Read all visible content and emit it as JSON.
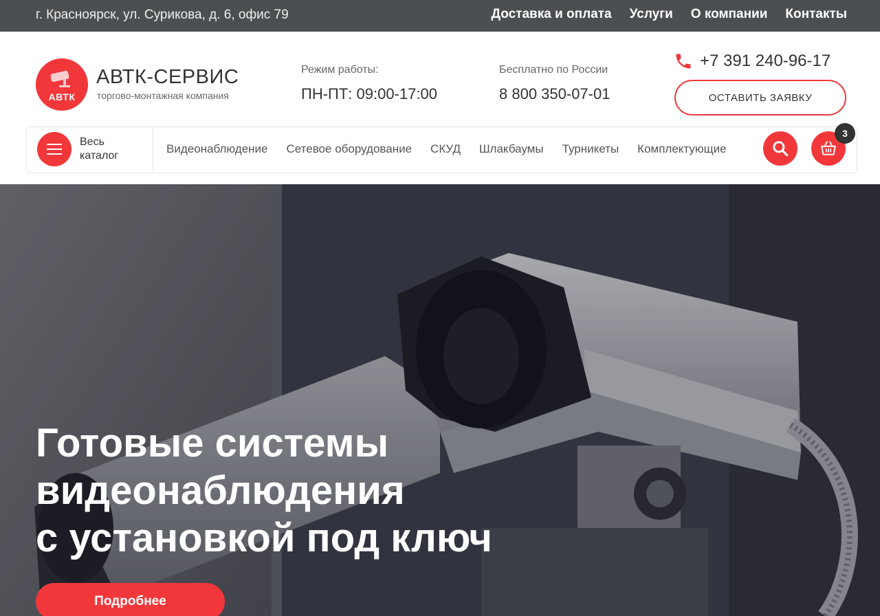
{
  "topbar": {
    "address": "г. Красноярск, ул. Сурикова, д. 6, офис 79",
    "nav": [
      "Доставка и оплата",
      "Услуги",
      "О компании",
      "Контакты"
    ]
  },
  "header": {
    "logo_text": "АВТК",
    "brand_name": "АВТК-СЕРВИС",
    "brand_sub": "торгово-монтажная компания",
    "hours_label": "Режим работы:",
    "hours_value": "ПН-ПТ: 09:00-17:00",
    "free_label": "Бесплатно по России",
    "free_phone": "8 800 350-07-01",
    "phone": "+7 391 240-96-17",
    "request_label": "ОСТАВИТЬ ЗАЯВКУ"
  },
  "catalog": {
    "button_label": "Весь каталог",
    "menu": [
      "Видеонаблюдение",
      "Сетевое оборудование",
      "СКУД",
      "Шлакбаумы",
      "Турникеты",
      "Комплектующие"
    ],
    "cart_count": "3"
  },
  "hero": {
    "title_lines": [
      "Готовые системы",
      "видеонаблюдения",
      "с установкой под ключ"
    ],
    "button_label": "Подробнее"
  },
  "colors": {
    "accent": "#f2373b",
    "topbar": "#4b4f51",
    "text": "#333333"
  },
  "icons": [
    "camera-logo-icon",
    "phone-icon",
    "menu-burger-icon",
    "search-icon",
    "cart-basket-icon"
  ]
}
